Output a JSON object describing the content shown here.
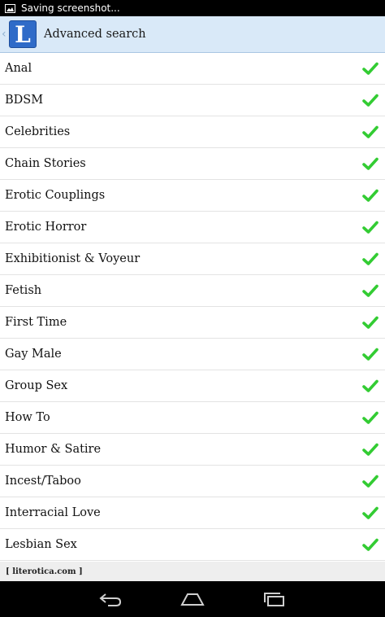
{
  "status_bar": {
    "text": "Saving screenshot..."
  },
  "action_bar": {
    "title": "Advanced search",
    "logo_letter": "L"
  },
  "categories": [
    {
      "label": "Anal",
      "checked": true
    },
    {
      "label": "BDSM",
      "checked": true
    },
    {
      "label": "Celebrities",
      "checked": true
    },
    {
      "label": "Chain Stories",
      "checked": true
    },
    {
      "label": "Erotic Couplings",
      "checked": true
    },
    {
      "label": "Erotic Horror",
      "checked": true
    },
    {
      "label": "Exhibitionist & Voyeur",
      "checked": true
    },
    {
      "label": "Fetish",
      "checked": true
    },
    {
      "label": "First Time",
      "checked": true
    },
    {
      "label": "Gay Male",
      "checked": true
    },
    {
      "label": "Group Sex",
      "checked": true
    },
    {
      "label": "How To",
      "checked": true
    },
    {
      "label": "Humor & Satire",
      "checked": true
    },
    {
      "label": "Incest/Taboo",
      "checked": true
    },
    {
      "label": "Interracial Love",
      "checked": true
    },
    {
      "label": "Lesbian Sex",
      "checked": true
    }
  ],
  "footer": {
    "text": "[ literotica.com ]"
  },
  "colors": {
    "check": "#33cc33",
    "action_bar": "#d9e9f8",
    "logo": "#2f6bc8"
  },
  "icons": {
    "status": "image-icon",
    "check": "checkmark-icon",
    "nav": [
      "back-icon",
      "home-icon",
      "recent-apps-icon"
    ]
  }
}
